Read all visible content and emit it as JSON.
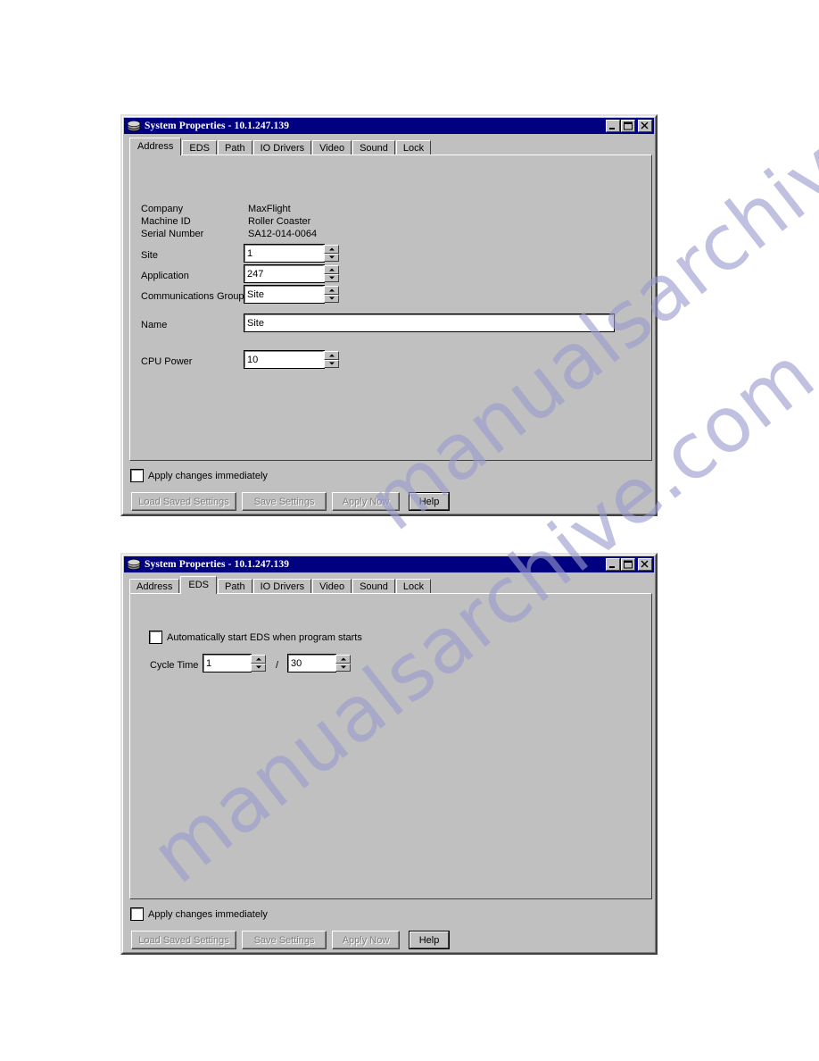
{
  "page": {
    "background": "#ffffff",
    "watermark": {
      "line1": "manualsarchive.com",
      "line2": "manualsarchive.com",
      "color": "#9a9ace"
    }
  },
  "colors": {
    "window_face": "#c0c0c0",
    "titlebar_active": "#000080",
    "titlebar_text": "#ffffff",
    "field_background": "#ffffff",
    "disabled_text": "#808080"
  },
  "window_address": {
    "title": "System Properties - 10.1.247.139",
    "icon": "disk-stack-icon",
    "title_buttons": [
      {
        "name": "minimize",
        "glyph": "_"
      },
      {
        "name": "maximize",
        "glyph": "□"
      },
      {
        "name": "close",
        "glyph": "✕"
      }
    ],
    "tabs": [
      {
        "label": "Address",
        "selected": true
      },
      {
        "label": "EDS",
        "selected": false
      },
      {
        "label": "Path",
        "selected": false
      },
      {
        "label": "IO Drivers",
        "selected": false
      },
      {
        "label": "Video",
        "selected": false
      },
      {
        "label": "Sound",
        "selected": false
      },
      {
        "label": "Lock",
        "selected": false
      }
    ],
    "info": [
      {
        "label": "Company",
        "value": "MaxFlight"
      },
      {
        "label": "Machine ID",
        "value": "Roller Coaster"
      },
      {
        "label": "Serial Number",
        "value": "SA12-014-0064"
      }
    ],
    "fields": {
      "site": {
        "label": "Site",
        "value": "1"
      },
      "application": {
        "label": "Application",
        "value": "247"
      },
      "comm_group": {
        "label": "Communications Group",
        "value": "Site"
      },
      "name": {
        "label": "Name",
        "value": "Site"
      },
      "cpu_power": {
        "label": "CPU Power",
        "value": "10"
      }
    },
    "apply_immediately": {
      "label": "Apply changes immediately",
      "checked": false
    },
    "buttons": [
      {
        "label": "Load Saved Settings",
        "enabled": false
      },
      {
        "label": "Save Settings",
        "enabled": false
      },
      {
        "label": "Apply Now",
        "enabled": false
      },
      {
        "label": "Help",
        "enabled": true
      }
    ]
  },
  "window_eds": {
    "title": "System Properties - 10.1.247.139",
    "icon": "disk-stack-icon",
    "title_buttons": [
      {
        "name": "minimize",
        "glyph": "_"
      },
      {
        "name": "maximize",
        "glyph": "□"
      },
      {
        "name": "close",
        "glyph": "✕"
      }
    ],
    "tabs": [
      {
        "label": "Address",
        "selected": false
      },
      {
        "label": "EDS",
        "selected": true
      },
      {
        "label": "Path",
        "selected": false
      },
      {
        "label": "IO Drivers",
        "selected": false
      },
      {
        "label": "Video",
        "selected": false
      },
      {
        "label": "Sound",
        "selected": false
      },
      {
        "label": "Lock",
        "selected": false
      }
    ],
    "autostart": {
      "label": "Automatically start EDS when program starts",
      "checked": false
    },
    "cycle_time": {
      "label": "Cycle Time",
      "value_numerator": "1",
      "separator": "/",
      "value_denominator": "30"
    },
    "apply_immediately": {
      "label": "Apply changes immediately",
      "checked": false
    },
    "buttons": [
      {
        "label": "Load Saved Settings",
        "enabled": false
      },
      {
        "label": "Save Settings",
        "enabled": false
      },
      {
        "label": "Apply Now",
        "enabled": false
      },
      {
        "label": "Help",
        "enabled": true
      }
    ]
  }
}
